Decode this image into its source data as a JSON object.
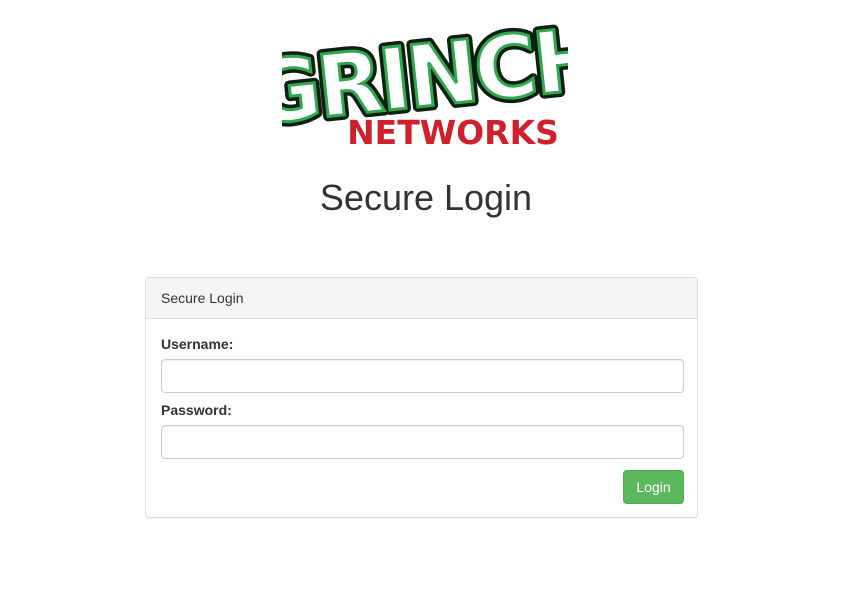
{
  "logo": {
    "top_text": "GRINCH",
    "bottom_text": "NETWORKS",
    "colors": {
      "green": "#2fa84f",
      "dark": "#0d1f10",
      "red": "#d0202e"
    }
  },
  "page_title": "Secure Login",
  "login_panel": {
    "heading": "Secure Login",
    "username_label": "Username:",
    "username_value": "",
    "password_label": "Password:",
    "password_value": "",
    "login_button_label": "Login"
  },
  "colors": {
    "button_green": "#5cb85c",
    "panel_heading_bg": "#f5f5f5",
    "border": "#dddddd"
  }
}
